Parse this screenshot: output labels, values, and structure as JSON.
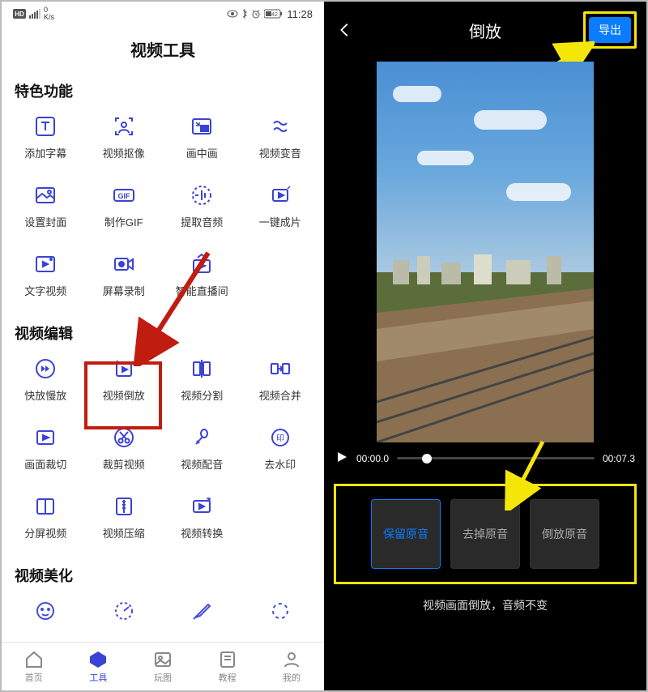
{
  "status": {
    "net_speed": "0",
    "net_unit": "K/s",
    "battery": "42",
    "time": "11:28"
  },
  "left": {
    "title": "视频工具",
    "sections": {
      "s1": "特色功能",
      "s2": "视频编辑",
      "s3": "视频美化"
    },
    "tools_s1": [
      {
        "label": "添加字幕"
      },
      {
        "label": "视频抠像"
      },
      {
        "label": "画中画"
      },
      {
        "label": "视频变音"
      },
      {
        "label": "设置封面"
      },
      {
        "label": "制作GIF"
      },
      {
        "label": "提取音频"
      },
      {
        "label": "一键成片"
      },
      {
        "label": "文字视频"
      },
      {
        "label": "屏幕录制"
      },
      {
        "label": "智能直播间"
      }
    ],
    "tools_s2": [
      {
        "label": "快放慢放"
      },
      {
        "label": "视频倒放"
      },
      {
        "label": "视频分割"
      },
      {
        "label": "视频合并"
      },
      {
        "label": "画面裁切"
      },
      {
        "label": "裁剪视频"
      },
      {
        "label": "视频配音"
      },
      {
        "label": "去水印"
      },
      {
        "label": "分屏视频"
      },
      {
        "label": "视频压缩"
      },
      {
        "label": "视频转换"
      }
    ],
    "bottomnav": [
      {
        "label": "首页"
      },
      {
        "label": "工具"
      },
      {
        "label": "玩图"
      },
      {
        "label": "教程"
      },
      {
        "label": "我的"
      }
    ]
  },
  "right": {
    "title": "倒放",
    "export": "导出",
    "time_start": "00:00.0",
    "time_end": "00:07.3",
    "options": [
      "保留原音",
      "去掉原音",
      "倒放原音"
    ],
    "footer": "视频画面倒放，音频不变"
  },
  "colors": {
    "accent": "#3b42d6",
    "export_bg": "#0a7cff",
    "highlight_yellow": "#f5e60a",
    "highlight_red": "#c01d10"
  }
}
